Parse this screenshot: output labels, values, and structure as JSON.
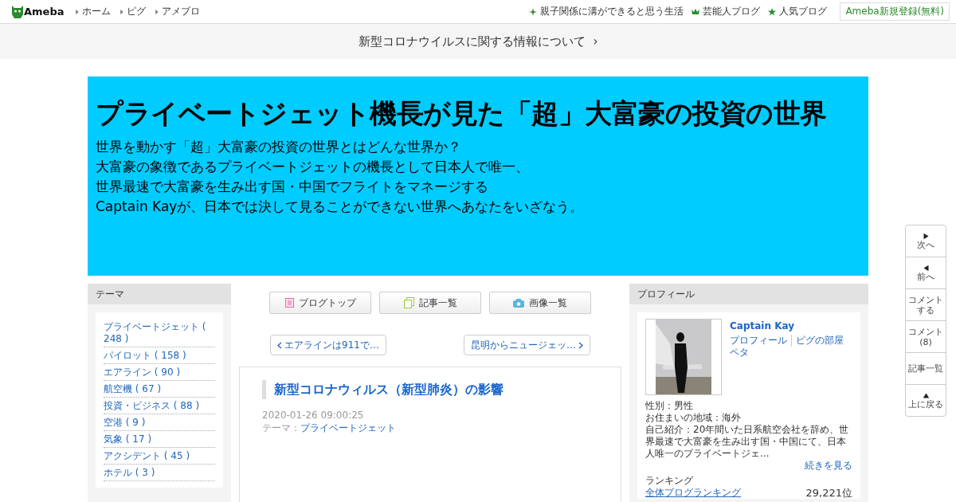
{
  "top_bar": {
    "logo": "Ameba",
    "nav": [
      "ホーム",
      "ピグ",
      "アメブロ"
    ],
    "links": [
      {
        "kind": "sparkle",
        "label": "親子関係に溝ができると思う生活"
      },
      {
        "kind": "crown",
        "label": "芸能人ブログ"
      },
      {
        "kind": "star",
        "label": "人気ブログ"
      }
    ],
    "signup": "Ameba新規登録(無料)"
  },
  "notice": {
    "text": "新型コロナウイルスに関する情報について",
    "arrow": "›"
  },
  "header": {
    "title": "プライベートジェット機長が見た「超」大富豪の投資の世界",
    "description": [
      "世界を動かす「超」大富豪の投資の世界とはどんな世界か？",
      "大富豪の象徴であるプライベートジェットの機長として日本人で唯一、",
      "世界最速で大富豪を生み出す国・中国でフライトをマネージする",
      "Captain Kayが、日本では決して見ることができない世界へあなたをいざなう。"
    ]
  },
  "theme_panel": {
    "heading": "テーマ",
    "items": [
      "プライベートジェット ( 248 )",
      "パイロット ( 158 )",
      "エアライン ( 90 )",
      "航空機 ( 67 )",
      "投資・ビジネス ( 88 )",
      "空港 ( 9 )",
      "気象 ( 17 )",
      "アクシデント ( 45 )",
      "ホテル ( 3 )"
    ]
  },
  "blog_buttons": [
    {
      "kind": "top",
      "label": "ブログトップ"
    },
    {
      "kind": "entries",
      "label": "記事一覧"
    },
    {
      "kind": "images",
      "label": "画像一覧"
    }
  ],
  "pager": {
    "prev": "エアラインは911で…",
    "next": "昆明からニュージェッ…"
  },
  "article": {
    "title": "新型コロナウィルス（新型肺炎）の影響",
    "date": "2020-01-26 09:00:25",
    "theme_label": "テーマ：",
    "theme": "プライベートジェット"
  },
  "profile": {
    "heading": "プロフィール",
    "name": "Captain Kay",
    "links": [
      "プロフィール",
      "ピグの部屋",
      "ペタ"
    ],
    "gender": "性別：男性",
    "region": "お住まいの地域：海外",
    "intro": "自己紹介：20年間いた日系航空会社を辞め、世界最速で大富豪を生み出す国・中国にて、日本人唯一のプライベートジェ...",
    "more": "続きを見る",
    "ranking_heading": "ランキング",
    "ranking_label": "全体ブログランキング",
    "ranking_value": "29,221位"
  },
  "side_nav": [
    {
      "kind": "next",
      "label": "次へ"
    },
    {
      "kind": "prev",
      "label": "前へ"
    },
    {
      "kind": "text",
      "label": "コメントする"
    },
    {
      "kind": "text",
      "label": "コメント(8)"
    },
    {
      "kind": "text",
      "label": "記事一覧"
    },
    {
      "kind": "up",
      "label": "上に戻る"
    }
  ]
}
